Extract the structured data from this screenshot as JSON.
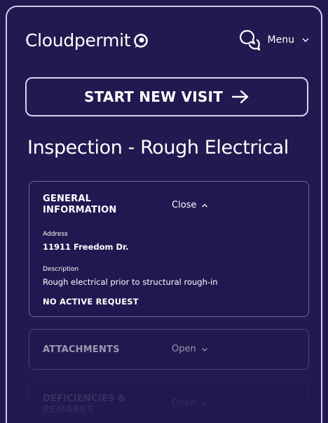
{
  "header": {
    "logo_text": "Cloudpermit",
    "logo_icon": "cloudpermit-logo-icon",
    "menu_label": "Menu",
    "chat_icon": "chat-bubbles-icon",
    "menu_chevron_icon": "chevron-down-icon"
  },
  "actions": {
    "start_visit_label": "START NEW VISIT",
    "start_visit_icon": "arrow-right-icon"
  },
  "page": {
    "title": "Inspection - Rough Electrical"
  },
  "sections": {
    "general": {
      "title": "GENERAL INFORMATION",
      "toggle_label": "Close",
      "toggle_icon": "chevron-up-icon",
      "address_label": "Address",
      "address_value": "11911 Freedom Dr.",
      "description_label": "Description",
      "description_value": "Rough electrical prior to structural rough-in",
      "status": "NO ACTIVE REQUEST"
    },
    "attachments": {
      "title": "ATTACHMENTS",
      "toggle_label": "Open",
      "toggle_icon": "chevron-down-icon"
    },
    "deficiencies": {
      "title": "DEFICIENCIES & REMARKS",
      "toggle_label": "Open",
      "toggle_icon": "chevron-down-icon"
    }
  },
  "colors": {
    "background": "#23184f",
    "border_light": "#d6d1ef",
    "panel_border": "#6f66a3",
    "text": "#ffffff"
  }
}
